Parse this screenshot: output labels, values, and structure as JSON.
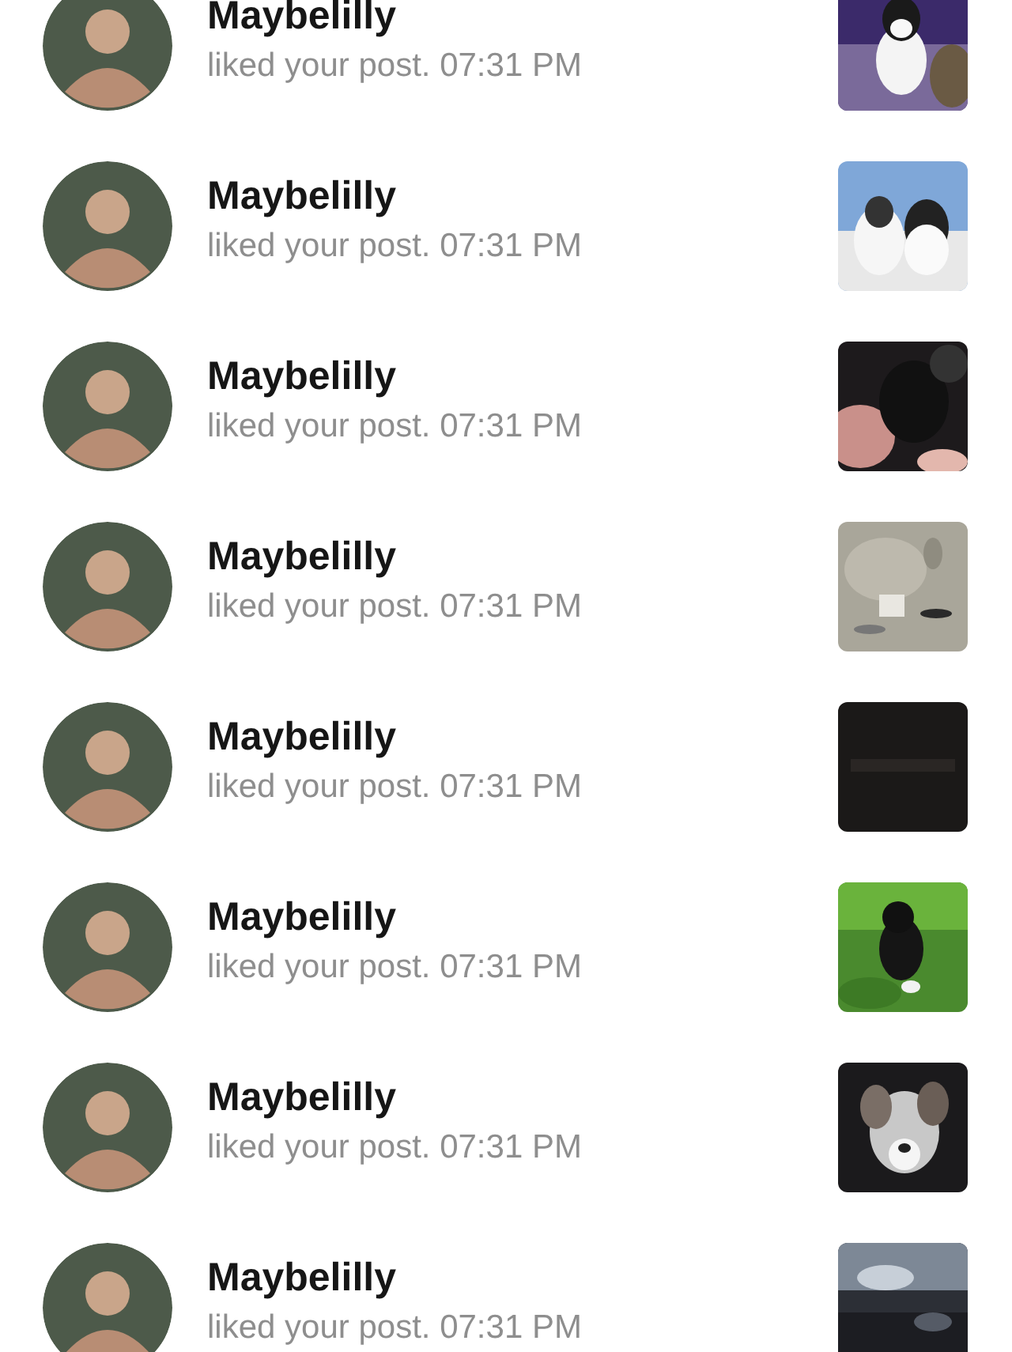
{
  "notifications": [
    {
      "user": "Maybelilly",
      "message": "liked your post. 07:31 PM"
    },
    {
      "user": "Maybelilly",
      "message": "liked your post. 07:31 PM"
    },
    {
      "user": "Maybelilly",
      "message": "liked your post. 07:31 PM"
    },
    {
      "user": "Maybelilly",
      "message": "liked your post. 07:31 PM"
    },
    {
      "user": "Maybelilly",
      "message": "liked your post. 07:31 PM"
    },
    {
      "user": "Maybelilly",
      "message": "liked your post. 07:31 PM"
    },
    {
      "user": "Maybelilly",
      "message": "liked your post. 07:31 PM"
    },
    {
      "user": "Maybelilly",
      "message": "liked your post. 07:31 PM"
    }
  ]
}
